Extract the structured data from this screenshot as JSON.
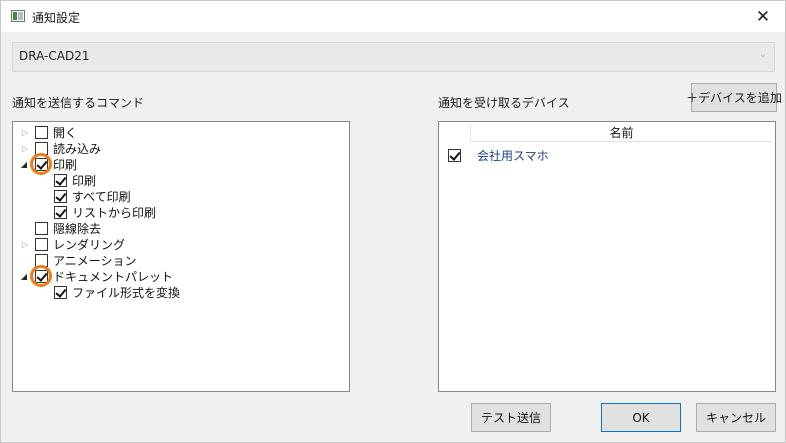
{
  "window": {
    "title": "通知設定",
    "close_glyph": "✕"
  },
  "project_combo": {
    "value": "DRA-CAD21",
    "arrow_glyph": "⌄"
  },
  "commands_panel": {
    "label": "通知を送信するコマンド",
    "items": [
      {
        "label": "開く",
        "checked": false,
        "expander": "collapsed"
      },
      {
        "label": "読み込み",
        "checked": false,
        "expander": "collapsed"
      },
      {
        "label": "印刷",
        "checked": true,
        "expander": "expanded",
        "highlighted": true
      },
      {
        "label": "印刷",
        "checked": true,
        "child": true
      },
      {
        "label": "すべて印刷",
        "checked": true,
        "child": true
      },
      {
        "label": "リストから印刷",
        "checked": true,
        "child": true
      },
      {
        "label": "隠線除去",
        "checked": false,
        "expander": "none"
      },
      {
        "label": "レンダリング",
        "checked": false,
        "expander": "collapsed"
      },
      {
        "label": "アニメーション",
        "checked": false,
        "expander": "none"
      },
      {
        "label": "ドキュメントパレット",
        "checked": true,
        "expander": "expanded",
        "highlighted": true
      },
      {
        "label": "ファイル形式を変換",
        "checked": true,
        "child": true
      }
    ]
  },
  "devices_panel": {
    "label": "通知を受け取るデバイス",
    "add_button_label": "＋デバイスを追加",
    "column_name": "名前",
    "rows": [
      {
        "name": "会社用スマホ",
        "checked": true
      }
    ]
  },
  "footer": {
    "test_button_label": "テスト送信",
    "ok_button_label": "OK",
    "cancel_button_label": "キャンセル"
  },
  "colors": {
    "highlight": "#ef7d17",
    "device_text": "#1f3f8f",
    "ok_border": "#0078d7"
  },
  "icons": {
    "app": "window-app-icon",
    "close": "close-icon",
    "expander_collapsed": "triangle-right-icon",
    "expander_expanded": "triangle-down-icon",
    "checkbox": "checkbox-icon",
    "highlight": "orange-circle-highlight"
  }
}
